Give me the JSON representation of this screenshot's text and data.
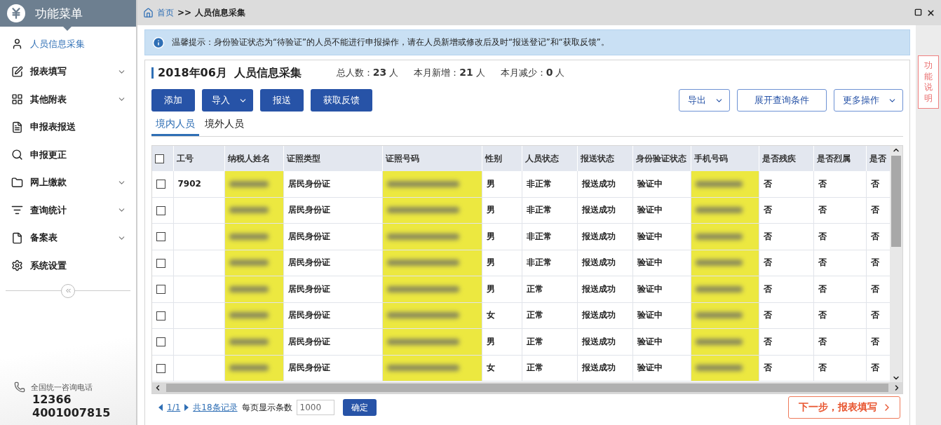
{
  "sidebar": {
    "title": "功能菜单",
    "items": [
      {
        "label": "人员信息采集",
        "selected": true,
        "expandable": false
      },
      {
        "label": "报表填写",
        "selected": false,
        "expandable": true
      },
      {
        "label": "其他附表",
        "selected": false,
        "expandable": true
      },
      {
        "label": "申报表报送",
        "selected": false,
        "expandable": false
      },
      {
        "label": "申报更正",
        "selected": false,
        "expandable": false
      },
      {
        "label": "网上缴款",
        "selected": false,
        "expandable": true
      },
      {
        "label": "查询统计",
        "selected": false,
        "expandable": true
      },
      {
        "label": "备案表",
        "selected": false,
        "expandable": true
      },
      {
        "label": "系统设置",
        "selected": false,
        "expandable": false
      }
    ],
    "hotline": {
      "label": "全国统一咨询电话",
      "numbers": [
        "12366",
        "4001007815"
      ]
    }
  },
  "breadcrumb": {
    "home": "首页",
    "separator": ">>",
    "current": "人员信息采集"
  },
  "notice": "温馨提示：身份验证状态为“待验证”的人员不能进行申报操作，请在人员新增或修改后及时“报送登记”和“获取反馈”。",
  "side_button": "功能说明",
  "header": {
    "period": "2018年06月",
    "title": "人员信息采集",
    "stats": [
      "总人数：**23** 人",
      "本月新增：**21** 人",
      "本月减少：**0** 人"
    ]
  },
  "toolbar": {
    "left": [
      {
        "label": "添加",
        "dropdown": false
      },
      {
        "label": "导入",
        "dropdown": true
      },
      {
        "label": "报送",
        "dropdown": false
      },
      {
        "label": "获取反馈",
        "dropdown": false
      }
    ],
    "right": [
      {
        "label": "导出",
        "dropdown": true
      },
      {
        "label": "展开查询条件",
        "dropdown": false
      },
      {
        "label": "更多操作",
        "dropdown": true
      }
    ]
  },
  "tabs": [
    {
      "label": "境内人员",
      "selected": true
    },
    {
      "label": "境外人员",
      "selected": false
    }
  ],
  "table": {
    "columns": [
      {
        "label": "工号",
        "redacted": false
      },
      {
        "label": "纳税人姓名",
        "redacted": true
      },
      {
        "label": "证照类型",
        "redacted": false
      },
      {
        "label": "证照号码",
        "redacted": true
      },
      {
        "label": "性别",
        "redacted": false
      },
      {
        "label": "人员状态",
        "redacted": false
      },
      {
        "label": "报送状态",
        "redacted": false
      },
      {
        "label": "身份验证状态",
        "redacted": false
      },
      {
        "label": "手机号码",
        "redacted": true
      },
      {
        "label": "是否残疾",
        "redacted": false
      },
      {
        "label": "是否烈属",
        "redacted": false
      },
      {
        "label": "是否",
        "redacted": false
      }
    ],
    "all_checked": false,
    "rows": [
      {
        "checked": false,
        "cells": [
          "7902",
          "",
          "居民身份证",
          "",
          "男",
          "非正常",
          "报送成功",
          "验证中",
          "",
          "否",
          "否",
          "否"
        ]
      },
      {
        "checked": false,
        "cells": [
          "",
          "",
          "居民身份证",
          "",
          "男",
          "非正常",
          "报送成功",
          "验证中",
          "",
          "否",
          "否",
          "否"
        ]
      },
      {
        "checked": false,
        "cells": [
          "",
          "",
          "居民身份证",
          "",
          "男",
          "非正常",
          "报送成功",
          "验证中",
          "",
          "否",
          "否",
          "否"
        ]
      },
      {
        "checked": false,
        "cells": [
          "",
          "",
          "居民身份证",
          "",
          "男",
          "非正常",
          "报送成功",
          "验证中",
          "",
          "否",
          "否",
          "否"
        ]
      },
      {
        "checked": false,
        "cells": [
          "",
          "",
          "居民身份证",
          "",
          "男",
          "正常",
          "报送成功",
          "验证中",
          "",
          "否",
          "否",
          "否"
        ]
      },
      {
        "checked": false,
        "cells": [
          "",
          "",
          "居民身份证",
          "",
          "女",
          "正常",
          "报送成功",
          "验证中",
          "",
          "否",
          "否",
          "否"
        ]
      },
      {
        "checked": false,
        "cells": [
          "",
          "",
          "居民身份证",
          "",
          "男",
          "正常",
          "报送成功",
          "验证中",
          "",
          "否",
          "否",
          "否"
        ]
      },
      {
        "checked": false,
        "cells": [
          "",
          "",
          "居民身份证",
          "",
          "女",
          "正常",
          "报送成功",
          "验证中",
          "",
          "否",
          "否",
          "否"
        ]
      }
    ]
  },
  "pagination": {
    "page": "1/1",
    "total": "共18条记录",
    "page_size_label": "每页显示条数",
    "page_size": "1000",
    "confirm": "确定"
  },
  "next_button": "下一步，报表填写"
}
